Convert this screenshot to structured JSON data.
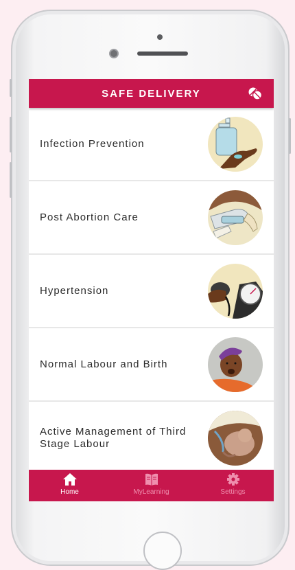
{
  "app": {
    "title": "SAFE DELIVERY",
    "top_right_icon": "pills-icon",
    "accent_color": "#c7174d"
  },
  "modules": [
    {
      "label": "Infection Prevention",
      "image": "hand-sanitizer-illustration"
    },
    {
      "label": "Post Abortion Care",
      "image": "post-abortion-care-illustration"
    },
    {
      "label": "Hypertension",
      "image": "blood-pressure-gauge-illustration"
    },
    {
      "label": "Normal Labour and Birth",
      "image": "woman-in-labour-illustration"
    },
    {
      "label": "Active Management of Third Stage Labour",
      "image": "newborn-baby-illustration"
    }
  ],
  "tabbar": {
    "tabs": [
      {
        "label": "Home",
        "icon": "home-icon",
        "active": true
      },
      {
        "label": "MyLearning",
        "icon": "book-icon",
        "active": false
      },
      {
        "label": "Settings",
        "icon": "gear-icon",
        "active": false
      }
    ]
  }
}
